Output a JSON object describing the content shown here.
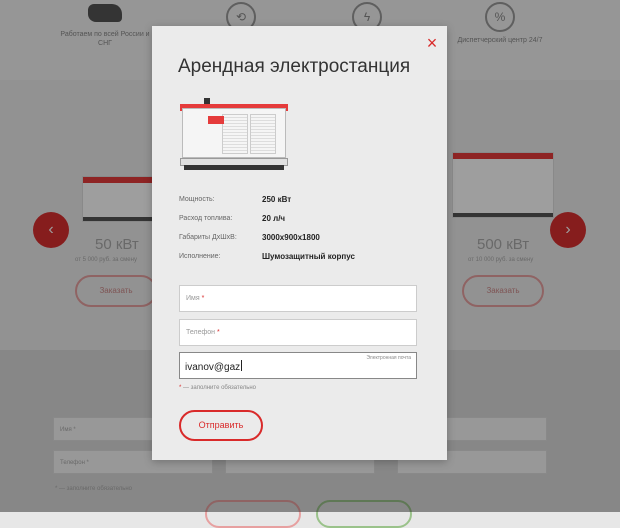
{
  "background": {
    "features": [
      {
        "icon": "russia-map-icon",
        "text": "Работаем по всей России и СНГ"
      },
      {
        "icon": "clock-24-icon",
        "text": ""
      },
      {
        "icon": "lightning-icon",
        "text": ""
      },
      {
        "icon": "dispatch-percent-icon",
        "text": "Диспетчерский центр 24/7"
      }
    ],
    "products": [
      {
        "power": "50 кВт",
        "sub": "от 5 000 руб. за смену"
      },
      {
        "power": "500 кВт",
        "sub": "от 10 000 руб. за смену"
      }
    ],
    "order_label": "Заказать",
    "form": {
      "fields": [
        "Имя *",
        "Телефон *",
        "",
        "",
        ""
      ],
      "note": "* — заполните обязательно"
    }
  },
  "modal": {
    "title": "Арендная электростанция",
    "close_icon": "close-icon",
    "specs": [
      {
        "label": "Мощность:",
        "value": "250 кВт"
      },
      {
        "label": "Расход топлива:",
        "value": "20 л/ч"
      },
      {
        "label": "Габариты ДхШхВ:",
        "value": "3000х900х1800"
      },
      {
        "label": "Исполнение:",
        "value": "Шумозащитный корпус"
      }
    ],
    "form": {
      "name_placeholder": "Имя",
      "phone_placeholder": "Телефон",
      "email_label": "Электронная почта",
      "email_value": "ivanov@gaz",
      "required_star": "*",
      "required_note": " — заполните обязательно",
      "submit_label": "Отправить"
    }
  },
  "colors": {
    "accent": "#d92a2a",
    "overlay": "rgba(0,0,0,0.38)"
  }
}
